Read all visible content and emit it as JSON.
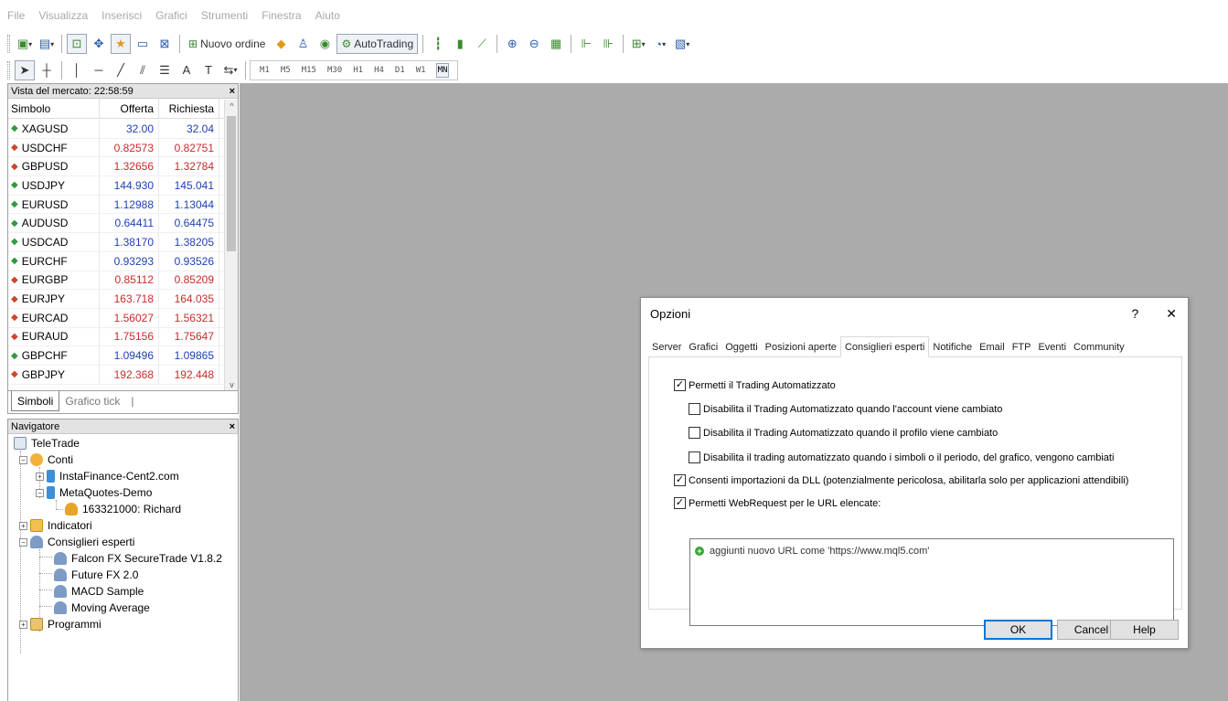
{
  "menubar": {
    "items": [
      "File",
      "Visualizza",
      "Inserisci",
      "Grafici",
      "Strumenti",
      "Finestra",
      "Aiuto"
    ]
  },
  "toolbar": {
    "new_order_label": "Nuovo ordine",
    "autotrading_label": "AutoTrading",
    "timeframes": [
      "M1",
      "M5",
      "M15",
      "M30",
      "H1",
      "H4",
      "D1",
      "W1",
      "MN"
    ],
    "active_timeframe": "MN"
  },
  "market_watch": {
    "title": "Vista del mercato: 22:58:59",
    "columns": {
      "symbol": "Simbolo",
      "bid": "Offerta",
      "ask": "Richiesta"
    },
    "rows": [
      {
        "symbol": "XAGUSD",
        "bid": "32.00",
        "ask": "32.04",
        "dir": "up"
      },
      {
        "symbol": "USDCHF",
        "bid": "0.82573",
        "ask": "0.82751",
        "dir": "down"
      },
      {
        "symbol": "GBPUSD",
        "bid": "1.32656",
        "ask": "1.32784",
        "dir": "down"
      },
      {
        "symbol": "USDJPY",
        "bid": "144.930",
        "ask": "145.041",
        "dir": "up"
      },
      {
        "symbol": "EURUSD",
        "bid": "1.12988",
        "ask": "1.13044",
        "dir": "up"
      },
      {
        "symbol": "AUDUSD",
        "bid": "0.64411",
        "ask": "0.64475",
        "dir": "up"
      },
      {
        "symbol": "USDCAD",
        "bid": "1.38170",
        "ask": "1.38205",
        "dir": "up"
      },
      {
        "symbol": "EURCHF",
        "bid": "0.93293",
        "ask": "0.93526",
        "dir": "up"
      },
      {
        "symbol": "EURGBP",
        "bid": "0.85112",
        "ask": "0.85209",
        "dir": "down"
      },
      {
        "symbol": "EURJPY",
        "bid": "163.718",
        "ask": "164.035",
        "dir": "down"
      },
      {
        "symbol": "EURCAD",
        "bid": "1.56027",
        "ask": "1.56321",
        "dir": "down"
      },
      {
        "symbol": "EURAUD",
        "bid": "1.75156",
        "ask": "1.75647",
        "dir": "down"
      },
      {
        "symbol": "GBPCHF",
        "bid": "1.09496",
        "ask": "1.09865",
        "dir": "up"
      },
      {
        "symbol": "GBPJPY",
        "bid": "192.368",
        "ask": "192.448",
        "dir": "down"
      }
    ],
    "tabs": [
      "Simboli",
      "Grafico tick"
    ]
  },
  "navigator": {
    "title": "Navigatore",
    "root": "TeleTrade",
    "accounts_label": "Conti",
    "account_1": "InstaFinance-Cent2.com",
    "account_2": "MetaQuotes-Demo",
    "account_2_user": "163321000: Richard",
    "indicators_label": "Indicatori",
    "experts_label": "Consiglieri esperti",
    "experts": [
      "Falcon FX SecureTrade V1.8.2",
      "Future FX 2.0",
      "MACD Sample",
      "Moving Average"
    ],
    "scripts_label": "Programmi"
  },
  "dialog": {
    "title": "Opzioni",
    "help_glyph": "?",
    "close_glyph": "✕",
    "tabs": [
      "Server",
      "Grafici",
      "Oggetti",
      "Posizioni aperte",
      "Consiglieri esperti",
      "Notifiche",
      "Email",
      "FTP",
      "Eventi",
      "Community"
    ],
    "active_tab": "Consiglieri esperti",
    "options": {
      "allow_autotrading": "Permetti il Trading Automatizzato",
      "disable_on_account": "Disabilita il Trading Automatizzato quando l'account viene cambiato",
      "disable_on_profile": "Disabilita il Trading Automatizzato quando il profilo viene cambiato",
      "disable_on_symbol": "Disabilita il trading automatizzato quando i simboli o il periodo, del grafico, vengono cambiati",
      "allow_dll": "Consenti importazioni da DLL (potenzialmente pericolosa, abilitarla solo per applicazioni attendibili)",
      "allow_webrequest": "Permetti WebRequest per le URL elencate:"
    },
    "url_placeholder": "aggiunti nuovo URL come 'https://www.mql5.com'",
    "buttons": {
      "ok": "OK",
      "cancel": "Cancel",
      "help": "Help"
    }
  },
  "colors": {
    "chart_bg": "#ababab",
    "tick_up": "#2f9a3c",
    "tick_down": "#d0452a",
    "value_up": "#1f3fb3",
    "value_down": "#c92a2a"
  }
}
